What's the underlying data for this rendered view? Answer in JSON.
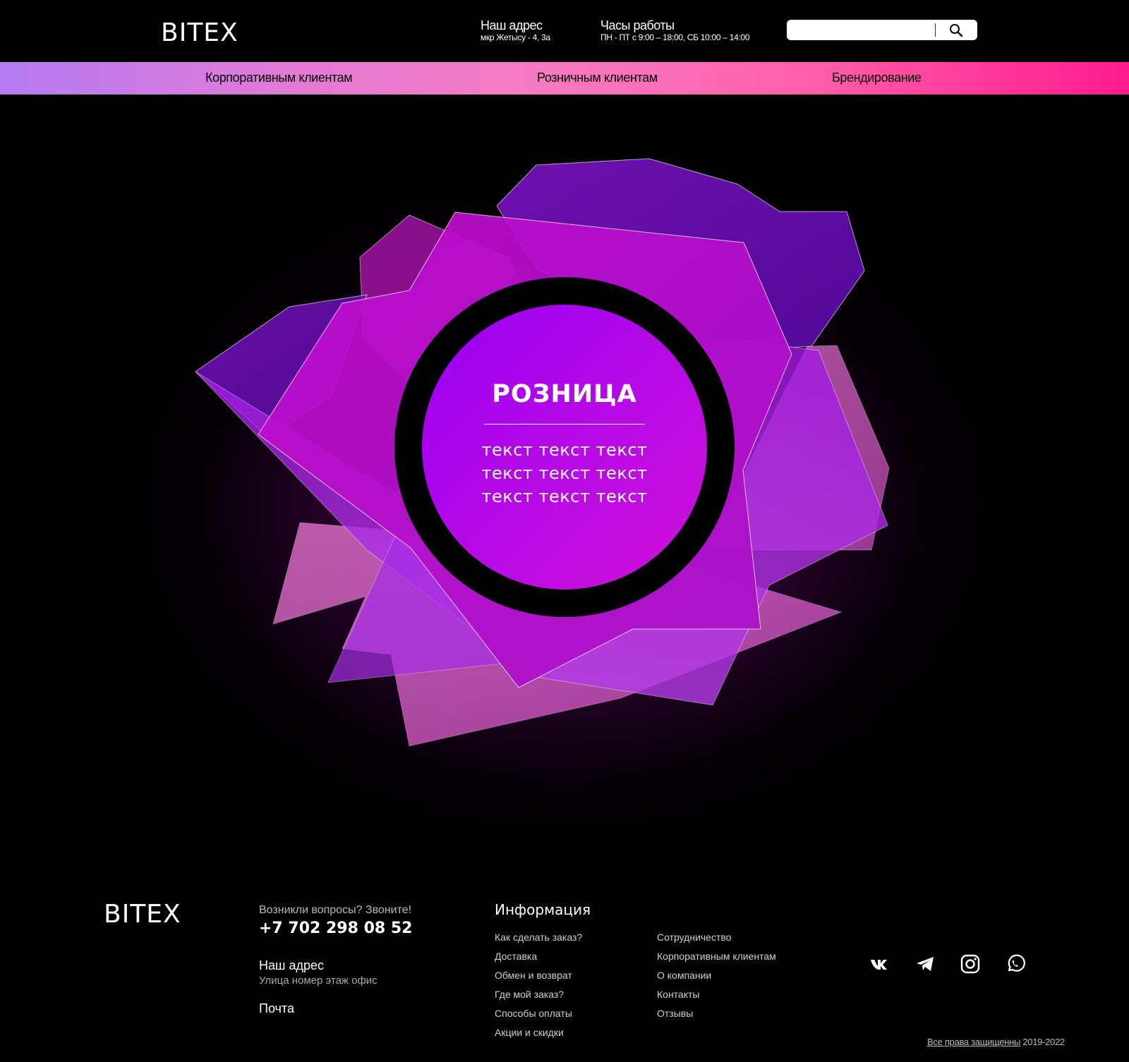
{
  "header": {
    "logo": "BITEX",
    "address_title": "Наш адрес",
    "address_value": "мкр Жетысу - 4, 3а",
    "hours_title": "Часы работы",
    "hours_value": "ПН - ПТ с 9:00 – 18:00,  СБ 10:00 – 14:00",
    "search": {
      "value": "",
      "icon": "search-icon"
    }
  },
  "nav": {
    "items": [
      {
        "label": "Корпоративным клиентам"
      },
      {
        "label": "Розничным клиентам"
      },
      {
        "label": "Брендирование"
      }
    ],
    "colors": [
      "#b57cf2",
      "#f57dc4",
      "#ff1c8c"
    ]
  },
  "hero": {
    "title": "РОЗНИЦА",
    "text_lines": [
      "текст текст текст",
      "текст текст текст",
      "текст текст текст"
    ],
    "colors": {
      "accent_purple": "#9a00f5",
      "accent_magenta": "#d012d8",
      "ring": "#000000"
    }
  },
  "footer": {
    "logo": "BITEX",
    "ask": "Возникли вопросы? Звоните!",
    "phone": "+7 702 298 08 52",
    "address_title": "Наш адрес",
    "address_value": "Улица номер этаж офис",
    "mail_title": "Почта",
    "info_title": "Информация",
    "links_col1": [
      "Как сделать заказ?",
      "Доставка",
      "Обмен и возврат",
      "Где мой заказ?",
      "Способы оплаты",
      "Акции и скидки"
    ],
    "links_col2": [
      "Сотрудничество",
      "Корпоративным клиентам",
      "О компании",
      "Контакты",
      "Отзывы"
    ],
    "socials": [
      "vk-icon",
      "telegram-icon",
      "instagram-icon",
      "whatsapp-icon"
    ],
    "copyright_link": "Все права защищенны",
    "copyright_years": "2019-2022"
  }
}
